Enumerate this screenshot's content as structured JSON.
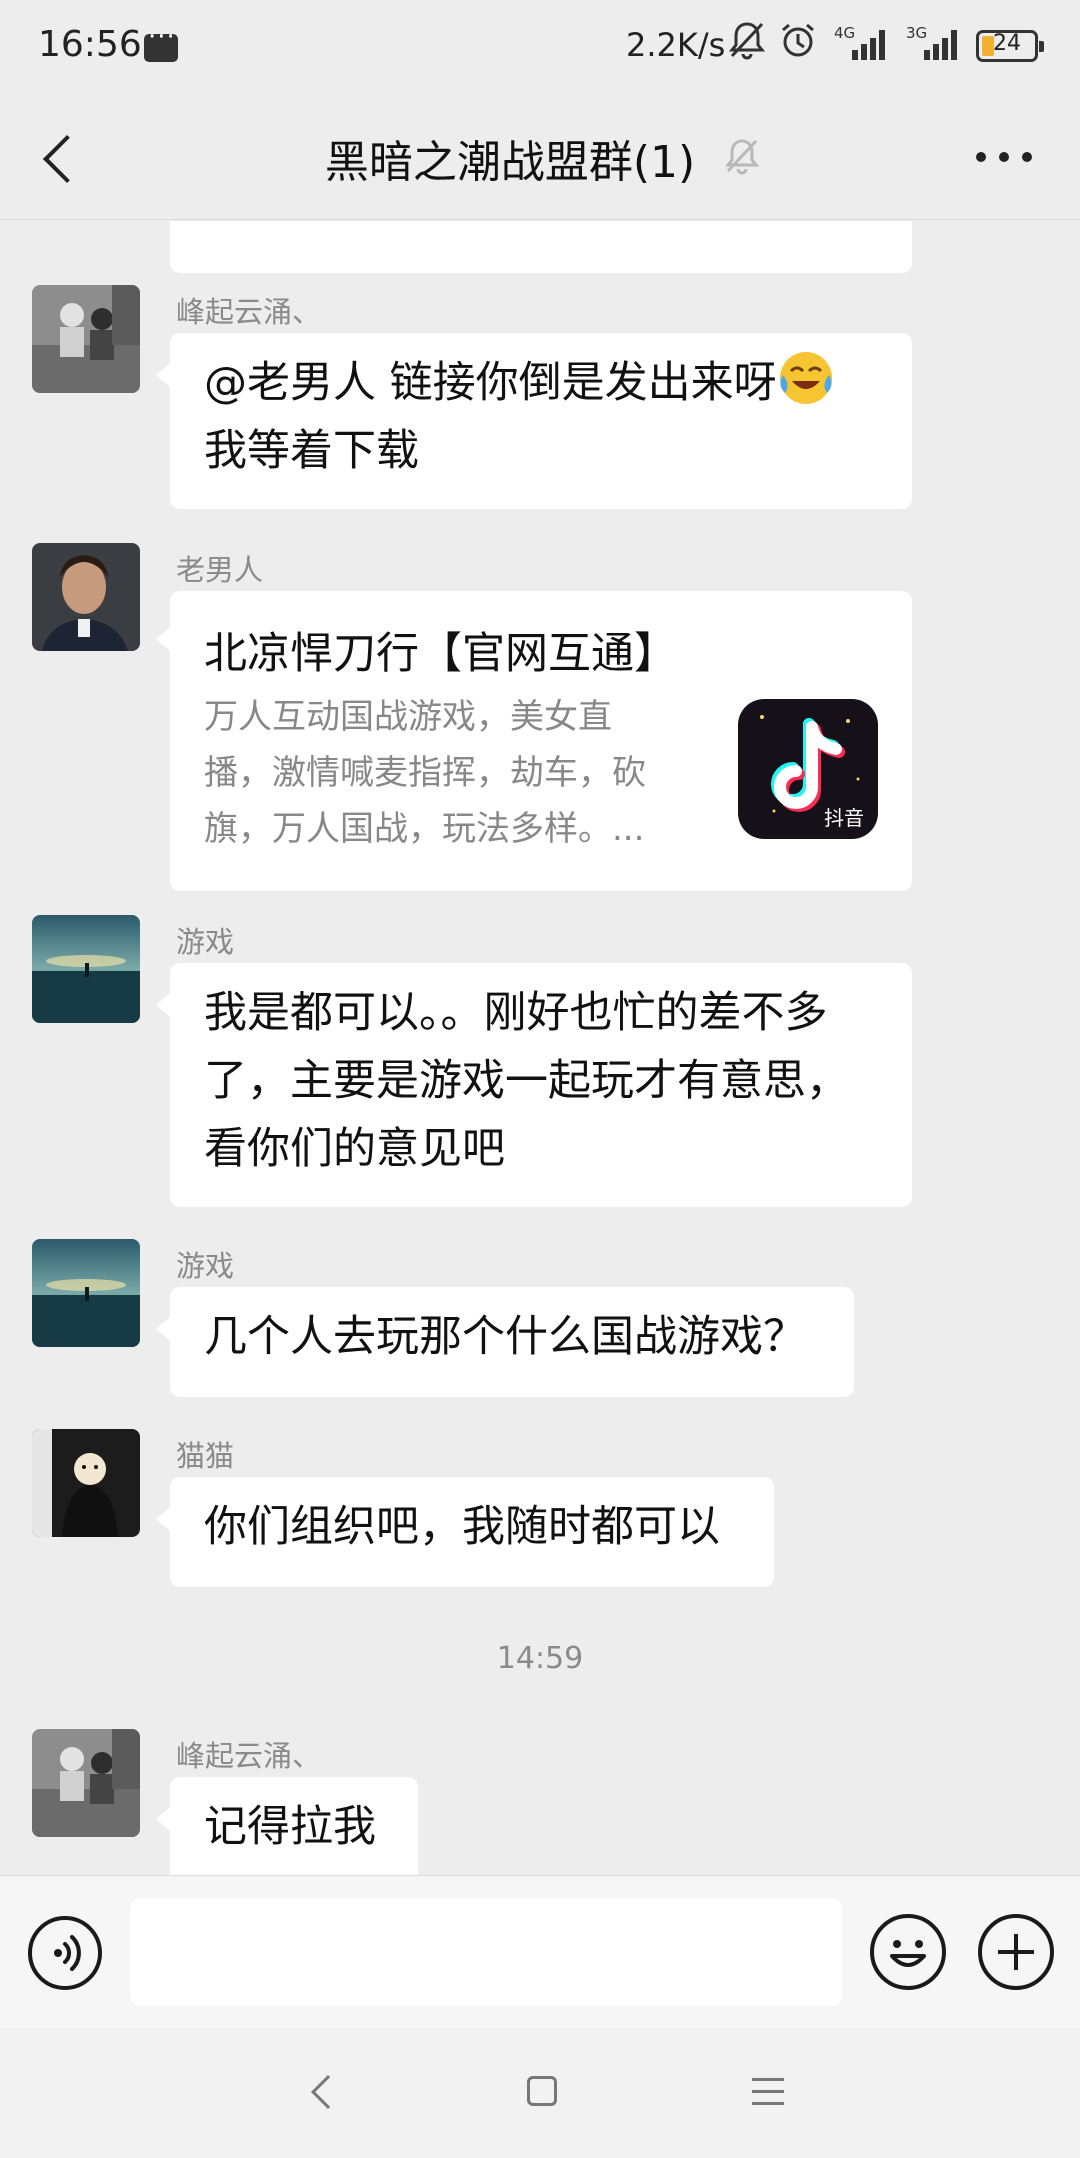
{
  "status_bar": {
    "time": "16:56",
    "network_speed": "2.2K/s",
    "signal_1_label": "4G",
    "signal_2_label": "3G",
    "battery_level": "24",
    "icons": [
      "message-icon",
      "mute-icon",
      "alarm-icon",
      "signal-icon",
      "battery-icon"
    ]
  },
  "header": {
    "title": "黑暗之潮战盟群(1)",
    "icons": [
      "back-icon",
      "mute-bell-icon",
      "more-icon"
    ]
  },
  "messages": [
    {
      "sender": "峰起云涌、",
      "lines": [
        "@老男人 链接你倒是发出来呀",
        "我等着下载"
      ],
      "emoji": "crying-laughing-emoji"
    },
    {
      "sender": "老男人",
      "card": {
        "title": "北凉悍刀行【官网互通】",
        "description_lines": [
          "万人互动国战游戏，美女直",
          "播，激情喊麦指挥，劫车，砍",
          "旗，万人国战，玩法多样。..."
        ],
        "thumbnail_label": "抖音",
        "thumbnail_icon": "douyin-logo-icon"
      }
    },
    {
      "sender": "游戏",
      "lines": [
        "我是都可以。。刚好也忙的差不多",
        "了，主要是游戏一起玩才有意思，",
        "看你们的意见吧"
      ]
    },
    {
      "sender": "游戏",
      "lines": [
        "几个人去玩那个什么国战游戏？"
      ]
    },
    {
      "sender": "猫猫",
      "lines": [
        "你们组织吧，我随时都可以"
      ]
    },
    {
      "sender": "峰起云涌、",
      "lines": [
        "记得拉我"
      ]
    }
  ],
  "time_divider": "14:59",
  "input_bar": {
    "placeholder": "",
    "icons": [
      "voice-icon",
      "emoji-icon",
      "plus-icon"
    ]
  },
  "nav_bar": {
    "icons": [
      "nav-back-icon",
      "nav-home-icon",
      "nav-menu-icon"
    ]
  },
  "colors": {
    "background": "#ededed",
    "bubble": "#ffffff",
    "sender_name": "#8a8a8a",
    "text": "#111111"
  }
}
